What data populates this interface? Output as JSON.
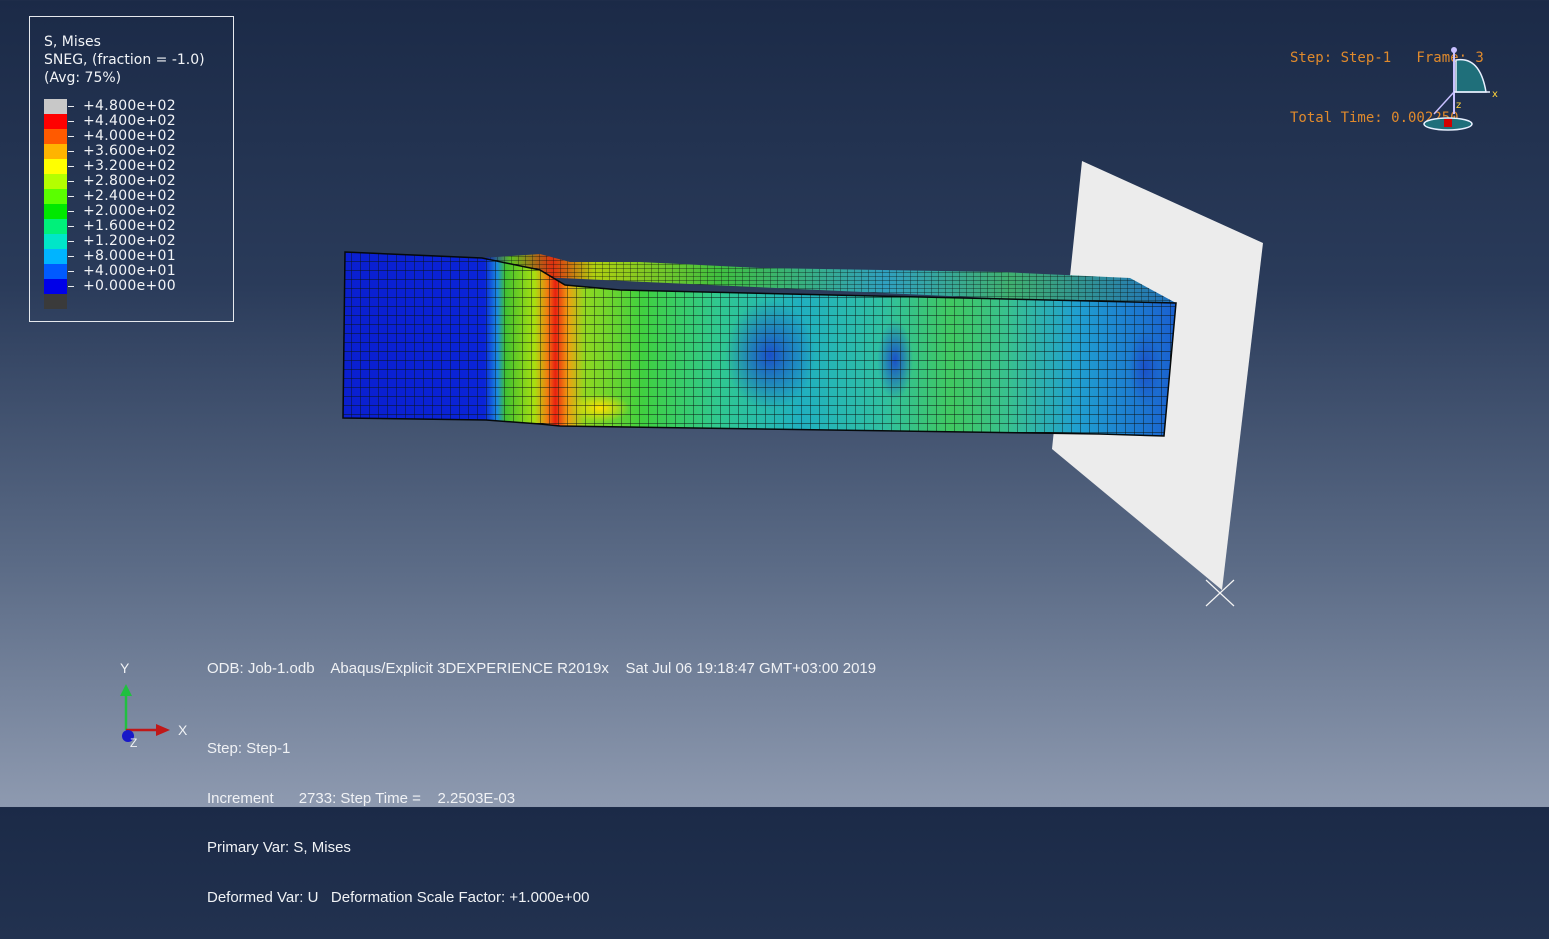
{
  "legend": {
    "title_lines": [
      "S, Mises",
      "SNEG, (fraction = -1.0)",
      "(Avg: 75%)"
    ],
    "levels": [
      {
        "label": "+4.800e+02",
        "color": "#c8c8c8"
      },
      {
        "label": "+4.400e+02",
        "color": "#ff0000"
      },
      {
        "label": "+4.000e+02",
        "color": "#ff5a00"
      },
      {
        "label": "+3.600e+02",
        "color": "#ffb400"
      },
      {
        "label": "+3.200e+02",
        "color": "#ffff00"
      },
      {
        "label": "+2.800e+02",
        "color": "#b4ff00"
      },
      {
        "label": "+2.400e+02",
        "color": "#5aff00"
      },
      {
        "label": "+2.000e+02",
        "color": "#00e800"
      },
      {
        "label": "+1.600e+02",
        "color": "#00f07a"
      },
      {
        "label": "+1.200e+02",
        "color": "#00e6c8"
      },
      {
        "label": "+8.000e+01",
        "color": "#00b4ff"
      },
      {
        "label": "+4.000e+01",
        "color": "#005aff"
      },
      {
        "label": "+0.000e+00",
        "color": "#0000e8"
      },
      {
        "label": "",
        "color": "#3a3a3a"
      }
    ]
  },
  "step_info": {
    "line1": "Step: Step-1   Frame: 3",
    "line2": "Total Time: 0.002250"
  },
  "odb_line": "ODB: Job-1.odb    Abaqus/Explicit 3DEXPERIENCE R2019x    Sat Jul 06 19:18:47 GMT+03:00 2019",
  "status": {
    "step": "Step: Step-1",
    "increment": "Increment      2733: Step Time =    2.2503E-03",
    "primary_var": "Primary Var: S, Mises",
    "deformed_var": "Deformed Var: U   Deformation Scale Factor: +1.000e+00"
  },
  "triad": {
    "x": "X",
    "y": "Y",
    "z": "Z"
  },
  "mini_triad": {
    "x": "x",
    "z": "z"
  },
  "colors": {
    "background_top": "#1b2a47",
    "background_bottom": "#8e9ab0",
    "info_orange": "#e08a2c",
    "plate": "#ececec"
  }
}
